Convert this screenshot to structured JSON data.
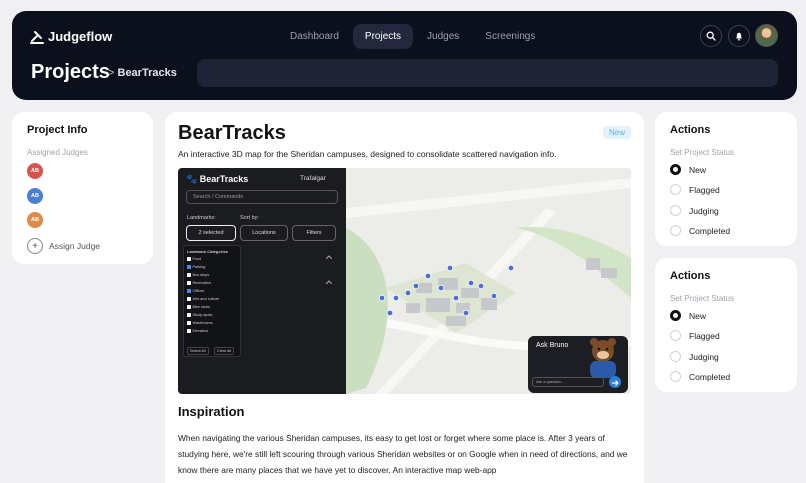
{
  "app": {
    "name": "Judgeflow"
  },
  "nav": {
    "items": [
      "Dashboard",
      "Projects",
      "Judges",
      "Screenings"
    ],
    "active": "Projects"
  },
  "header": {
    "title": "Projects",
    "breadcrumb_sep": ">",
    "breadcrumb_current": "BearTracks"
  },
  "project_info": {
    "title": "Project Info",
    "assigned_label": "Assigned Judges",
    "judges": [
      {
        "initials": "AB",
        "color": "#d9534f"
      },
      {
        "initials": "AB",
        "color": "#4a7fd6"
      },
      {
        "initials": "AB",
        "color": "#e08a4a"
      }
    ],
    "assign_label": "Assign Judge"
  },
  "project": {
    "title": "BearTracks",
    "status_badge": "New",
    "description": "An interactive 3D map for the Sheridan campuses, designed to consolidate scattered navigation info.",
    "screenshot": {
      "app_title": "BearTracks",
      "campus": "Trafalgar",
      "command_placeholder": "Search / Commands",
      "landmarks_label": "Landmarks:",
      "sort_label": "Sort by:",
      "selected_pill": "2 selected",
      "locations_pill": "Locations",
      "filters_pill": "Filters",
      "dropdown_title": "Landmark Categories",
      "categories": [
        {
          "label": "Food",
          "checked": false
        },
        {
          "label": "Parking",
          "checked": true
        },
        {
          "label": "Bus stops",
          "checked": false
        },
        {
          "label": "Recreation",
          "checked": false
        },
        {
          "label": "Offices",
          "checked": true
        },
        {
          "label": "Arts and culture",
          "checked": false
        },
        {
          "label": "Bike racks",
          "checked": false
        },
        {
          "label": "Study spots",
          "checked": false
        },
        {
          "label": "Washrooms",
          "checked": false
        },
        {
          "label": "Elevators",
          "checked": false
        }
      ],
      "select_all": "Select All",
      "clear_all": "Clear All",
      "chat_title": "Ask Bruno",
      "chat_placeholder": "Ask a question..."
    },
    "inspiration_title": "Inspiration",
    "inspiration_text": "When navigating the various Sheridan campuses, its easy to get lost or forget where some place is. After 3 years of studying here, we're still left scouring through various Sheridan websites or on Google when in need of directions, and we know there are many places that we have yet to discover. An interactive map web-app"
  },
  "actions_cards": [
    {
      "title": "Actions",
      "status_label": "Set Project Status",
      "options": [
        "New",
        "Flagged",
        "Judging",
        "Completed"
      ],
      "selected": "New"
    },
    {
      "title": "Actions",
      "status_label": "Set Project Status",
      "options": [
        "New",
        "Flagged",
        "Judging",
        "Completed"
      ],
      "selected": "New"
    }
  ],
  "colors": {
    "header_bg": "#0c0f1c",
    "accent": "#2c7fd6",
    "badge_text": "#66b2e0"
  }
}
